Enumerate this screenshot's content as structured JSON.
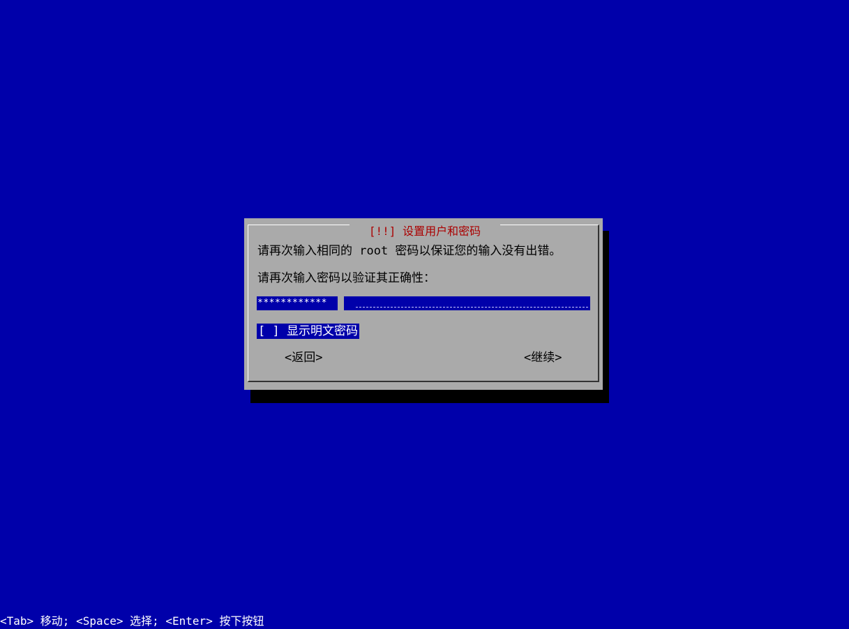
{
  "dialog": {
    "title": "[!!] 设置用户和密码",
    "message": "请再次输入相同的 root 密码以保证您的输入没有出错。",
    "prompt": "请再次输入密码以验证其正确性：",
    "password_value": "************",
    "show_password_checkbox": "[ ] 显示明文密码",
    "back_button": "<返回>",
    "continue_button": "<继续>"
  },
  "help_line": "<Tab> 移动; <Space> 选择; <Enter> 按下按钮",
  "colors": {
    "background": "#0000aa",
    "dialog": "#aaaaaa",
    "title": "#aa0000",
    "shadow": "#000000"
  }
}
